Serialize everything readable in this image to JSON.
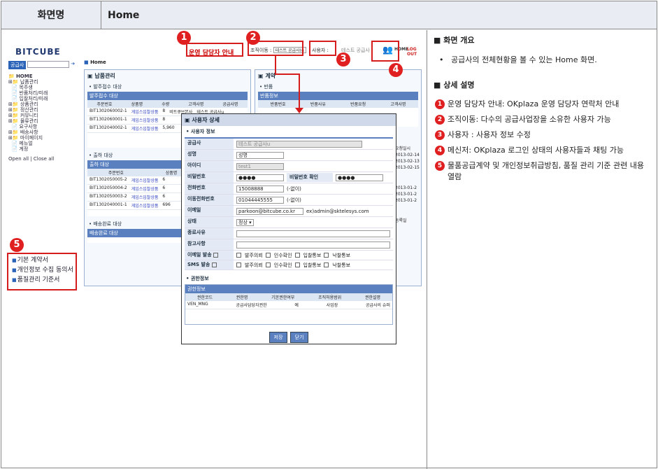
{
  "header": {
    "label": "화면명",
    "title": "Home"
  },
  "app": {
    "logo": "BITCUBE",
    "top_link": "운영 담당자 안내",
    "org_label": "조직이동 :",
    "org_value": "테스트 공급사(u",
    "user_label": "사용자 :",
    "user_value": "테스트 공급사",
    "home": "HOME",
    "logout": "LOG OUT",
    "search_tab": "공급사",
    "breadcrumb": "Home"
  },
  "sidebar": {
    "items": [
      "HOME",
      "납품관리",
      "목주생",
      "반품처리/미래",
      "입찰처리/미래",
      "상품관리",
      "정산관리",
      "커뮤니티",
      "물류관리",
      "요구사항",
      "배송사항",
      "마이페이지",
      "메뉴얼",
      "계정"
    ],
    "footer": "Open all | Close all"
  },
  "panels": {
    "delivery": {
      "title": "납품관리",
      "sub1": "발주접수 대상",
      "grid1": "발주접수 대상",
      "cols": [
        "주문번호",
        "상품명",
        "수량",
        "고객사명",
        "공급사명"
      ],
      "rows1": [
        [
          "BIT1302060002-1",
          "게임스입찰상품",
          "8",
          "비트큐브본사",
          "테스트 공급사u"
        ],
        [
          "BIT1302060001-1",
          "게임스입찰상품",
          "8"
        ],
        [
          "BIT1302040002-1",
          "게임스입찰상품",
          "5,960"
        ]
      ],
      "sub2": "출하 대상",
      "grid2": "출하 대상",
      "rows2": [
        [
          "BIT1302050005-2",
          "게임스입찰상품",
          "6"
        ],
        [
          "BIT1302050004-2",
          "게임스입찰상품",
          "6"
        ],
        [
          "BIT1302050003-2",
          "게임스입찰상품",
          "6"
        ],
        [
          "BIT1302040001-1",
          "게임스입찰상품",
          "696"
        ]
      ],
      "sub3": "배송완료 대상",
      "grid3": "배송완료 대상"
    },
    "return": {
      "title": "계약",
      "sub1": "반품",
      "grid": "반품정보",
      "cols": [
        "반품번호",
        "반품사유",
        "반품요청",
        "고객사명"
      ],
      "dates": [
        "2013-02-14",
        "2013-02-13",
        "2013-02-15",
        "2013-01-2",
        "2013-01-2",
        "2013-01-2"
      ],
      "side": [
        "요청일시",
        "등록일"
      ]
    }
  },
  "dialog": {
    "title": "사용자 상세",
    "section1": "사용자 정보",
    "fields": {
      "company_l": "공급사",
      "company_v": "테스트 공급사u",
      "name_l": "성명",
      "name_v": "성명",
      "id_l": "아이디",
      "id_v": "test1",
      "pw_l": "비밀번호",
      "pw_v": "●●●●",
      "pw2_l": "비밀번호 확인",
      "pw2_v": "●●●●",
      "tel_l": "전화번호",
      "tel_v": "15008888",
      "tel_h": "(-없이)",
      "mobile_l": "이동전화번호",
      "mobile_v": "01044445555",
      "mobile_h": "(-없이)",
      "email_l": "이메일",
      "email_v": "parkoon@bitcube.co.kr",
      "email_h": "ex)admin@sktelesys.com",
      "status_l": "상태",
      "status_v": "정상",
      "stop_l": "종료사유",
      "note_l": "참고사항",
      "mail_l": "이메일 발송",
      "sms_l": "SMS 발송",
      "opts": [
        "발주의뢰",
        "인수확인",
        "입찰통보",
        "낙찰통보"
      ]
    },
    "section2": "권한정보",
    "grid_title": "권한정보",
    "grid_cols": [
      "권한코드",
      "권한명",
      "기본권한여부",
      "조직허용범위",
      "권한설명"
    ],
    "grid_row": [
      "VEN_MNG",
      "공급사담당자권한",
      "예",
      "사업장",
      "공급사의 슈퍼"
    ],
    "save": "저장",
    "close": "닫기"
  },
  "links": [
    "기본 계약서",
    "개인정보 수집 동의서",
    "품질관리 기준서"
  ],
  "desc": {
    "overview_title": "■ 화면 개요",
    "overview": "공급사의 전체현황을 볼 수 있는 Home 화면.",
    "detail_title": "■ 상세 설명",
    "items": [
      "운영 담당자 안내: OKplaza 운영 담당자 연락처 안내",
      "조직이동: 다수의 공급사업장을 소유한 사용자 가능",
      "사용자 : 사용자 정보 수정",
      "메신저: OKplaza 로그인 상태의 사용자들과 채팅 가능",
      "물품공급계약 및 개인정보취급방침, 품질 관리 기준 관련 내용 열람"
    ]
  }
}
